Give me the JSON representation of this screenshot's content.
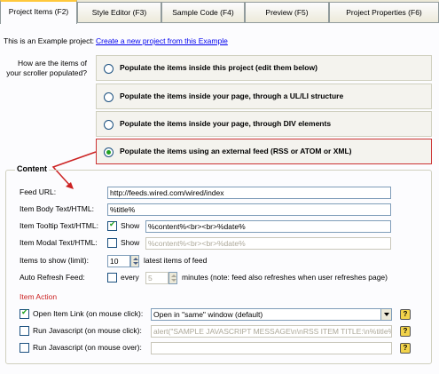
{
  "tabs": [
    {
      "label": "Project Items   (F2)"
    },
    {
      "label": "Style Editor   (F3)"
    },
    {
      "label": "Sample Code   (F4)"
    },
    {
      "label": "Preview     (F5)"
    },
    {
      "label": "Project Properties   (F6)"
    }
  ],
  "example": {
    "label": "This is an Example project:",
    "link": "Create a new project from this Example"
  },
  "populate": {
    "question": "How are the items of your scroller populated?",
    "options": [
      {
        "label": "Populate the items inside this project (edit them below)",
        "selected": false
      },
      {
        "label": "Populate the items inside your page, through a UL/LI structure",
        "selected": false
      },
      {
        "label": "Populate the items inside your page, through DIV elements",
        "selected": false
      },
      {
        "label": "Populate the items using an external feed (RSS or ATOM or XML)",
        "selected": true
      }
    ]
  },
  "content": {
    "title": "Content",
    "feed_url_label": "Feed URL:",
    "feed_url_value": "http://feeds.wired.com/wired/index",
    "body_label": "Item Body Text/HTML:",
    "body_value": "%title%",
    "tooltip_label": "Item Tooltip Text/HTML:",
    "tooltip_show_label": "Show",
    "tooltip_show_checked": true,
    "tooltip_value": "%content%<br><br>%date%",
    "modal_label": "Item Modal Text/HTML:",
    "modal_show_label": "Show",
    "modal_show_checked": false,
    "modal_value": "%content%<br><br>%date%",
    "items_label": "Items to show (limit):",
    "items_value": "10",
    "items_suffix": "latest items of feed",
    "refresh_label": "Auto Refresh Feed:",
    "refresh_every_label": "every",
    "refresh_value": "5",
    "refresh_suffix": "minutes (note: feed also refreshes when user refreshes page)"
  },
  "action": {
    "title": "Item Action",
    "open_link_label": "Open Item Link (on mouse click):",
    "open_link_checked": true,
    "open_link_value": "Open in \"same\" window (default)",
    "js_click_label": "Run Javascript (on mouse click):",
    "js_click_value": "alert(\"SAMPLE JAVASCRIPT MESSAGE\\n\\nRSS ITEM TITLE:\\n%title%\\n",
    "js_over_label": "Run Javascript (on mouse over):",
    "js_over_value": "",
    "help_glyph": "?"
  },
  "colors": {
    "accent_red": "#cc3333",
    "link_blue": "#0000ee",
    "help_yellow": "#f2d34a"
  }
}
